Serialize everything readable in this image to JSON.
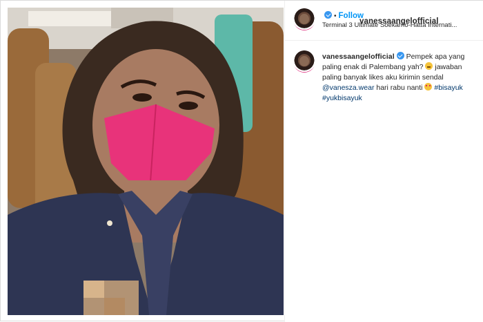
{
  "post": {
    "username": "vanessaangelofficial",
    "follow_label": "Follow",
    "location": "Terminal 3 Ultimate Soekarno-Hatta Internati...",
    "caption": {
      "username": "vanessaangelofficial",
      "line1": "Pempek apa yang paling enak di Palembang yah?",
      "line2": "jawaban paling banyak likes aku kirimin sendal",
      "mention": "@vanesza.wear",
      "line3": "hari rabu nanti",
      "hashtags": [
        "#bisayuk",
        "#yukbisayuk"
      ]
    },
    "icons": {
      "verified": "verified-badge-icon",
      "emoji_1": "thinking-face-emoji-icon",
      "emoji_2": "smiling-face-with-hearts-emoji-icon"
    }
  },
  "colors": {
    "accent": "#0095f6",
    "link": "#00376b",
    "verified": "#3897f0",
    "mask": "#e8337a"
  }
}
